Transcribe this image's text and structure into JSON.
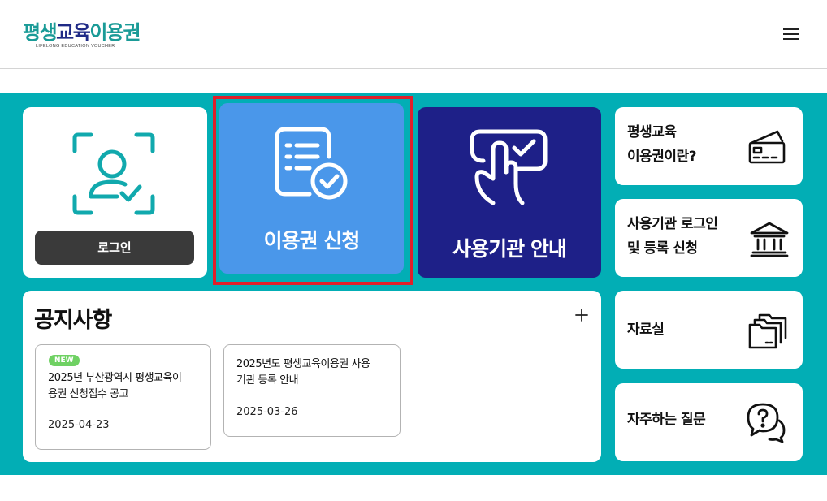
{
  "header": {
    "logo": {
      "part1": "평생",
      "part2": "교육",
      "part3": "이용권",
      "subtitle": "LIFELONG EDUCATION VOUCHER"
    },
    "menu_icon": "hamburger-menu-icon"
  },
  "tiles": {
    "login": {
      "button_label": "로그인",
      "icon": "face-scan-check-icon"
    },
    "apply": {
      "label": "이용권 신청",
      "icon": "document-check-icon"
    },
    "institution": {
      "label": "사용기관 안내",
      "icon": "touch-check-icon"
    }
  },
  "side": [
    {
      "line1": "평생교육",
      "line2": "이용권이란?",
      "icon": "card-icon"
    },
    {
      "line1": "사용기관 로그인",
      "line2": "및 등록 신청",
      "icon": "institution-icon"
    },
    {
      "line1": "자료실",
      "icon": "folders-icon"
    },
    {
      "line1": "자주하는 질문",
      "icon": "faq-bubble-icon"
    }
  ],
  "notice": {
    "title": "공지사항",
    "more_icon": "plus-icon",
    "items": [
      {
        "badge": "NEW",
        "line1": "2025년 부산광역시 평생교육이",
        "line2": "용권 신청접수 공고",
        "date": "2025-04-23"
      },
      {
        "line1": "2025년도 평생교육이용권 사용",
        "line2": "기관 등록 안내",
        "date": "2025-03-26"
      }
    ]
  },
  "colors": {
    "teal_bg": "#02aeb5",
    "apply_blue": "#4a97ea",
    "navy": "#1e2088",
    "highlight_red": "#e01f2a",
    "new_badge": "#6fd163"
  }
}
